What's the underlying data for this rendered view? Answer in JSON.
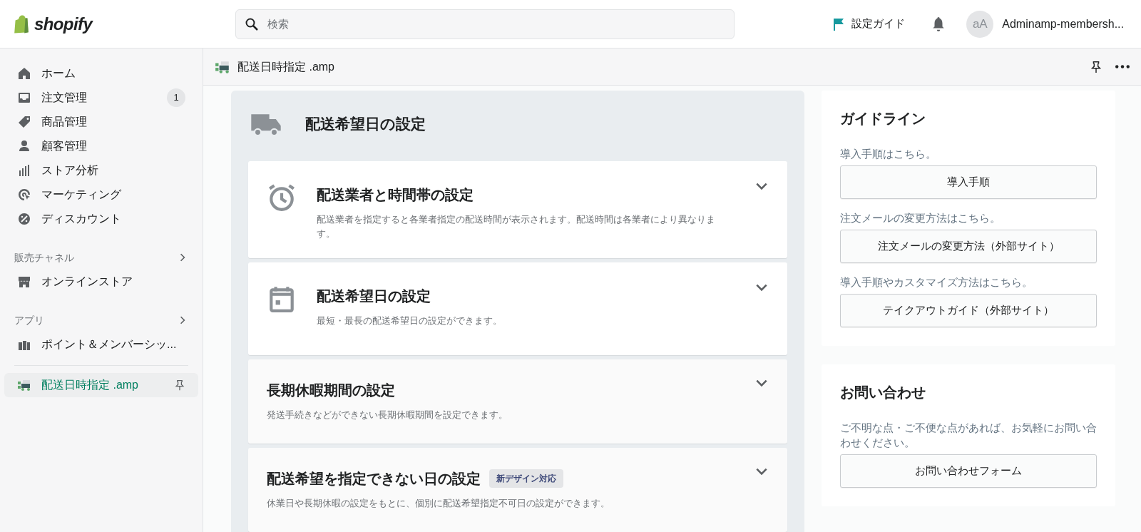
{
  "topbar": {
    "logo": "shopify",
    "search": {
      "placeholder": "検索"
    },
    "setup_guide": "設定ガイド",
    "avatar": "aA",
    "account": "Adminamp-membersh..."
  },
  "sidebar": {
    "items": [
      {
        "label": "ホーム",
        "selected": false
      },
      {
        "label": "注文管理",
        "badge": "1",
        "selected": false
      },
      {
        "label": "商品管理",
        "selected": false
      },
      {
        "label": "顧客管理",
        "selected": false
      },
      {
        "label": "ストア分析",
        "selected": false
      },
      {
        "label": "マーケティング",
        "selected": false
      },
      {
        "label": "ディスカウント",
        "selected": false
      }
    ],
    "sections": [
      {
        "title": "販売チャネル",
        "items": [
          {
            "label": "オンラインストア",
            "selected": false
          }
        ]
      },
      {
        "title": "アプリ",
        "items": [
          {
            "label": "ポイント＆メンバーシッ...",
            "selected": false
          }
        ]
      }
    ],
    "pinned": {
      "label": "配送日時指定 .amp",
      "selected": true
    }
  },
  "app_header": {
    "title": "配送日時指定 .amp"
  },
  "main": {
    "title": "配送希望日の設定",
    "cards": [
      {
        "kind": "clock",
        "title": "配送業者と時間帯の設定",
        "description": "配送業者を指定すると各業者指定の配送時間が表示されます。配送時間は各業者により異なります。"
      },
      {
        "kind": "calendar",
        "title": "配送希望日の設定",
        "description": "最短・最長の配送希望日の設定ができます。"
      },
      {
        "kind": "plain",
        "title": "長期休暇期間の設定",
        "description": "発送手続きなどができない長期休暇期間を設定できます。"
      },
      {
        "kind": "plain",
        "title": "配送希望を指定できない日の設定",
        "badge": "新デザイン対応",
        "description": "休業日や長期休暇の設定をもとに、個別に配送希望指定不可日の設定ができます。"
      }
    ]
  },
  "guidelines": {
    "title": "ガイドライン",
    "entries": [
      {
        "text": "導入手順はこちら。",
        "button": "導入手順"
      },
      {
        "text": "注文メールの変更方法はこちら。",
        "button": "注文メールの変更方法（外部サイト）"
      },
      {
        "text": "導入手順やカスタマイズ方法はこちら。",
        "button": "テイクアウトガイド（外部サイト）"
      }
    ]
  },
  "contact": {
    "title": "お問い合わせ",
    "text": "ご不明な点・ご不便な点があれば、お気軽にお問い合わせください。",
    "button": "お問い合わせフォーム"
  }
}
